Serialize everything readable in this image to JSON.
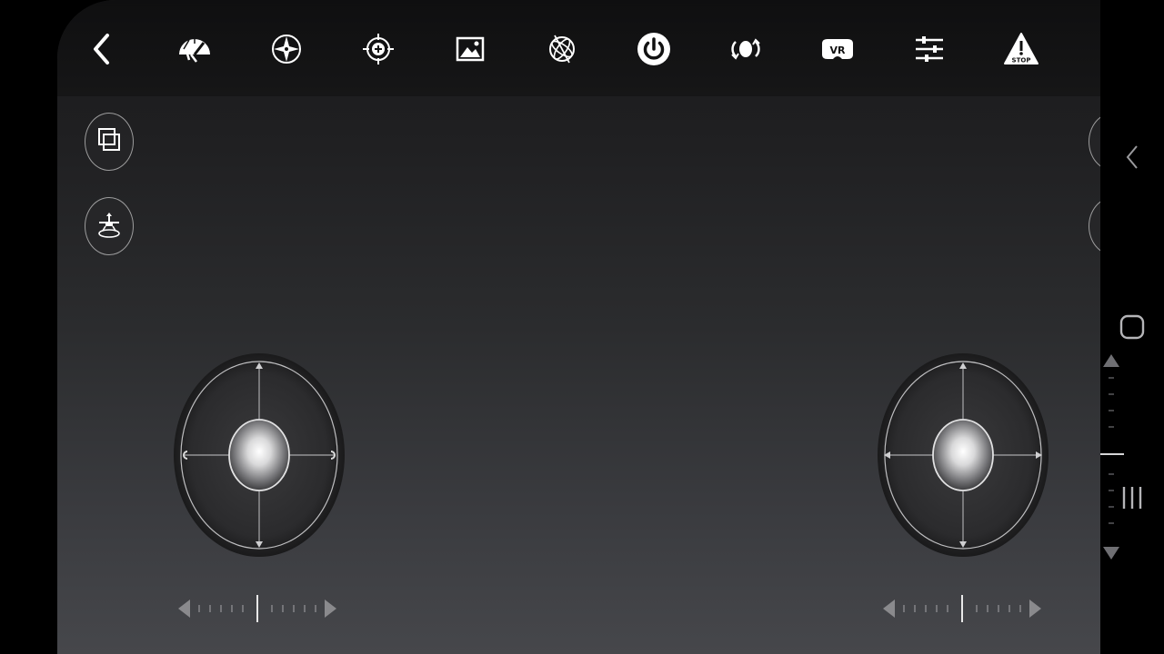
{
  "topbar": {
    "icons": [
      {
        "name": "back-chevron-icon"
      },
      {
        "name": "speed-gauge-icon"
      },
      {
        "name": "compass-icon"
      },
      {
        "name": "headless-target-icon"
      },
      {
        "name": "gallery-image-icon"
      },
      {
        "name": "gyro-calibrate-icon"
      },
      {
        "name": "power-icon"
      },
      {
        "name": "flip-360-icon"
      },
      {
        "name": "vr-headset-icon"
      },
      {
        "name": "adjust-sliders-icon"
      },
      {
        "name": "emergency-stop-icon",
        "label": "STOP"
      },
      {
        "name": "settings-gear-icon"
      }
    ]
  },
  "left_buttons": [
    {
      "name": "switch-view-icon"
    },
    {
      "name": "takeoff-landing-icon"
    }
  ],
  "right_buttons": [
    {
      "name": "camera-icon"
    },
    {
      "name": "video-camera-icon"
    }
  ],
  "joysticks": {
    "left": {
      "role": "throttle-yaw"
    },
    "right": {
      "role": "pitch-roll"
    }
  },
  "colors": {
    "accent": "#ffffff",
    "background_top": "#1c1c1d",
    "background_bottom": "#46474b"
  }
}
